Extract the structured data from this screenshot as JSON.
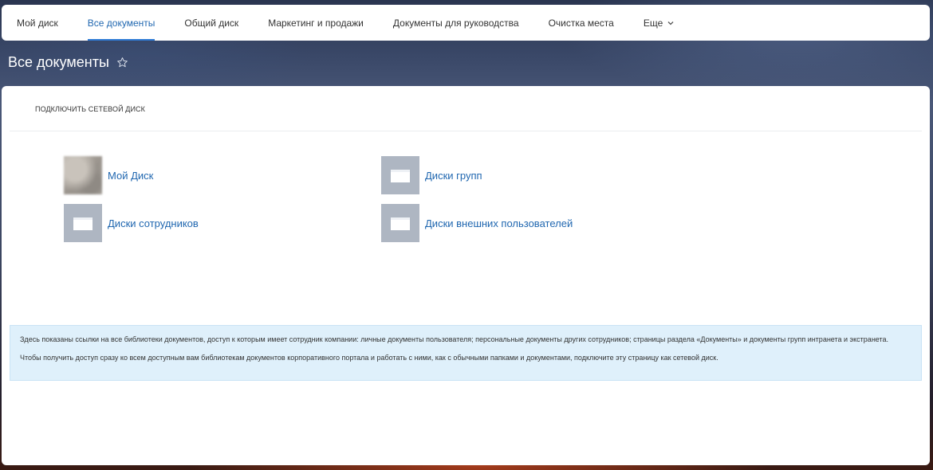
{
  "nav": {
    "items": [
      {
        "label": "Мой диск"
      },
      {
        "label": "Все документы"
      },
      {
        "label": "Общий диск"
      },
      {
        "label": "Маркетинг и продажи"
      },
      {
        "label": "Документы для руководства"
      },
      {
        "label": "Очистка места"
      },
      {
        "label": "Еще"
      }
    ],
    "active_index": 1
  },
  "page": {
    "title": "Все документы"
  },
  "panel": {
    "connect_label": "ПОДКЛЮЧИТЬ СЕТЕВОЙ ДИСК",
    "libraries": [
      {
        "label": "Мой Диск",
        "icon": "user-avatar"
      },
      {
        "label": "Диски групп",
        "icon": "folder-icon"
      },
      {
        "label": "Диски сотрудников",
        "icon": "folder-icon"
      },
      {
        "label": "Диски внешних пользователей",
        "icon": "folder-icon"
      }
    ],
    "info": {
      "line1": "Здесь показаны ссылки на все библиотеки документов, доступ к которым имеет сотрудник компании: личные документы пользователя; персональные документы других сотрудников; страницы раздела «Документы» и документы групп интранета и экстранета.",
      "line2": "Чтобы получить доступ сразу ко всем доступным вам библиотекам документов корпоративного портала и работать с ними, как с обычными папками и документами, подключите эту страницу как сетевой диск."
    }
  },
  "colors": {
    "accent": "#2f7cd6",
    "link": "#2067b0",
    "folder": "#aeb6c2",
    "info_bg": "#dff0fb"
  }
}
